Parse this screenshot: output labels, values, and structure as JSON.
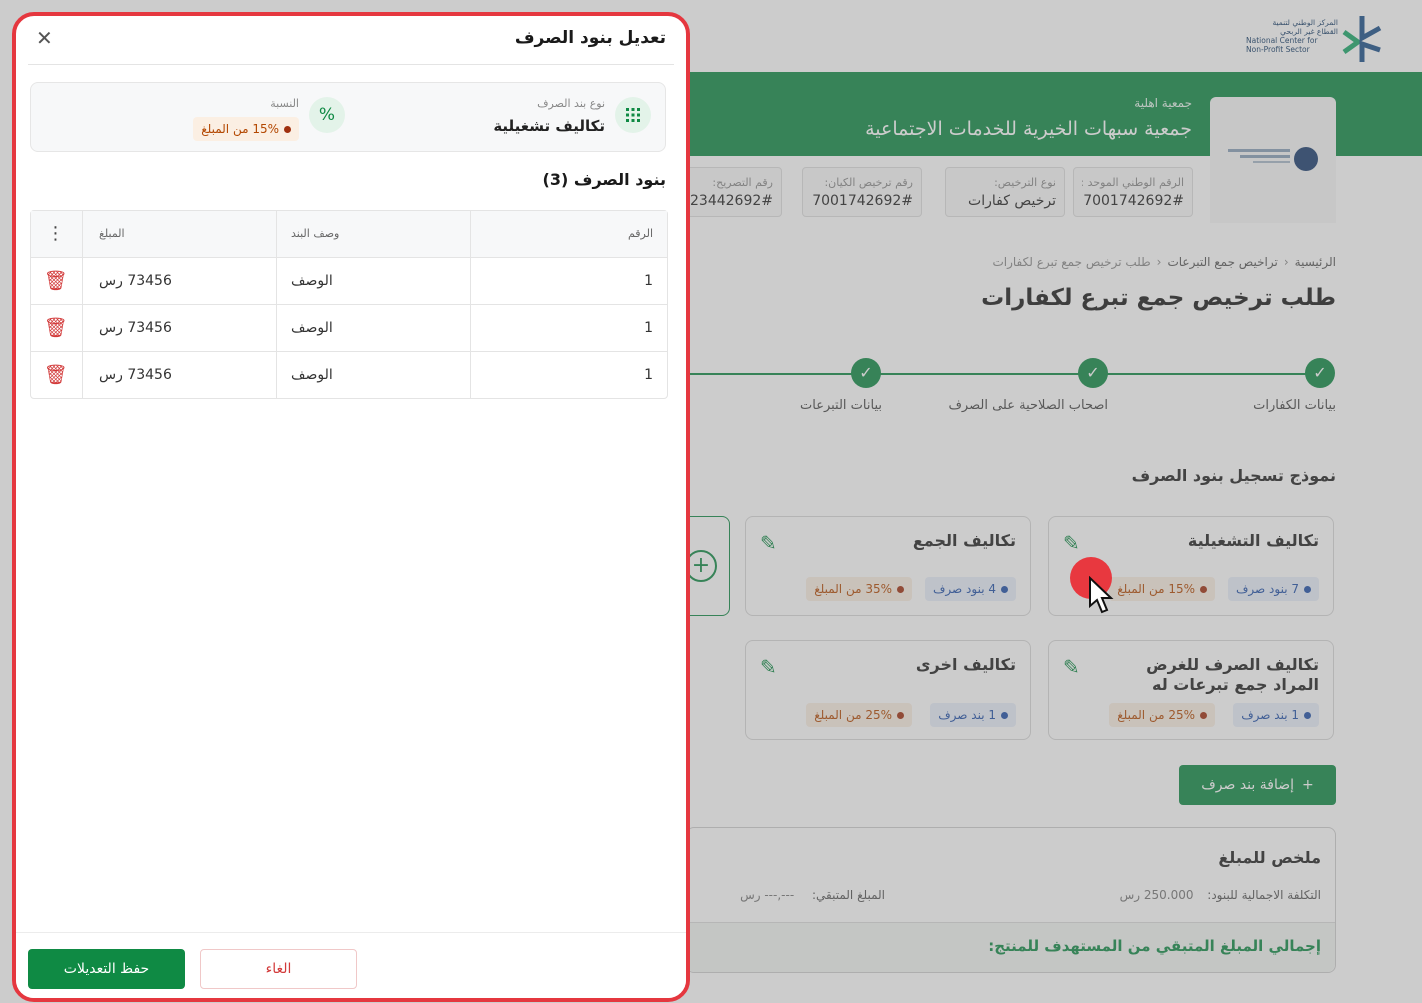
{
  "colors": {
    "brand_green": "#0f8a44",
    "highlight_red": "#e5373f",
    "chip_blue": "#1f4fa8",
    "chip_orange": "#b34700"
  },
  "logo": {
    "line1": "المركز الوطني لتنمية",
    "line2": "القطاع غير الربحي",
    "line3": "National Center for",
    "line4": "Non-Profit Sector"
  },
  "header": {
    "org_type": "جمعية اهلية",
    "org_name": "جمعية سبهات الخيرية للخدمات الاجتماعية",
    "info_cards": [
      {
        "label": "الرقم الوطني الموحد :",
        "value": "7001742692#"
      },
      {
        "label": "نوع الترخيص:",
        "value": "ترخيص كفارات"
      },
      {
        "label": "رقم ترخيص الكيان:",
        "value": "7001742692#"
      },
      {
        "label": "رقم التصريح:",
        "value": "23442692#"
      }
    ]
  },
  "breadcrumb": {
    "home": "الرئيسية",
    "licenses": "تراخيص جمع التبرعات",
    "current": "طلب ترخيص جمع تبرع لكفارات"
  },
  "page_title": "طلب ترخيص جمع تبرع لكفارات",
  "steps": [
    "بيانات الكفارات",
    "اصحاب الصلاحية على الصرف",
    "بيانات التبرعات"
  ],
  "section_title": "نموذج تسجيل بنود الصرف",
  "categories": [
    {
      "title": "تكاليف التشغيلية",
      "items": "7 بنود صرف",
      "percent": "15% من المبلغ"
    },
    {
      "title": "تكاليف الجمع",
      "items": "4 بنود صرف",
      "percent": "35% من المبلغ"
    },
    {
      "title": "تكاليف الصرف للغرض المراد جمع تبرعات له",
      "items": "1 بند صرف",
      "percent": "25% من المبلغ"
    },
    {
      "title": "تكاليف اخرى",
      "items": "1 بند صرف",
      "percent": "25% من المبلغ"
    }
  ],
  "add_item_label": "إضافة بند صرف",
  "summary": {
    "title": "ملخص للمبلغ",
    "total_label": "التكلفة الاجمالية للبنود:",
    "total_value": "250.000 رس",
    "remaining_label": "المبلغ المتبقي:",
    "remaining_value": "---,--- رس",
    "band_text": "إجمالي المبلغ المتبقي من المستهدف للمنتج:"
  },
  "drawer": {
    "title": "تعديل بنود الصرف",
    "type_label": "نوع بند الصرف",
    "type_value": "تكاليف تشغيلية",
    "ratio_label": "النسبة",
    "ratio_value": "15% من المبلغ",
    "items_heading": "بنود الصرف (3)",
    "table": {
      "headers": [
        "الرقم",
        "وصف البند",
        "المبلغ"
      ],
      "rows": [
        {
          "num": "1",
          "desc": "الوصف",
          "amount": "73456 رس"
        },
        {
          "num": "1",
          "desc": "الوصف",
          "amount": "73456 رس"
        },
        {
          "num": "1",
          "desc": "الوصف",
          "amount": "73456 رس"
        }
      ]
    },
    "save_label": "حفظ التعديلات",
    "cancel_label": "الغاء"
  },
  "icons": [
    "close-icon",
    "grid-icon",
    "percent-icon",
    "more-vertical-icon",
    "trash-icon",
    "pencil-icon",
    "plus-icon",
    "check-icon",
    "cursor-icon"
  ]
}
